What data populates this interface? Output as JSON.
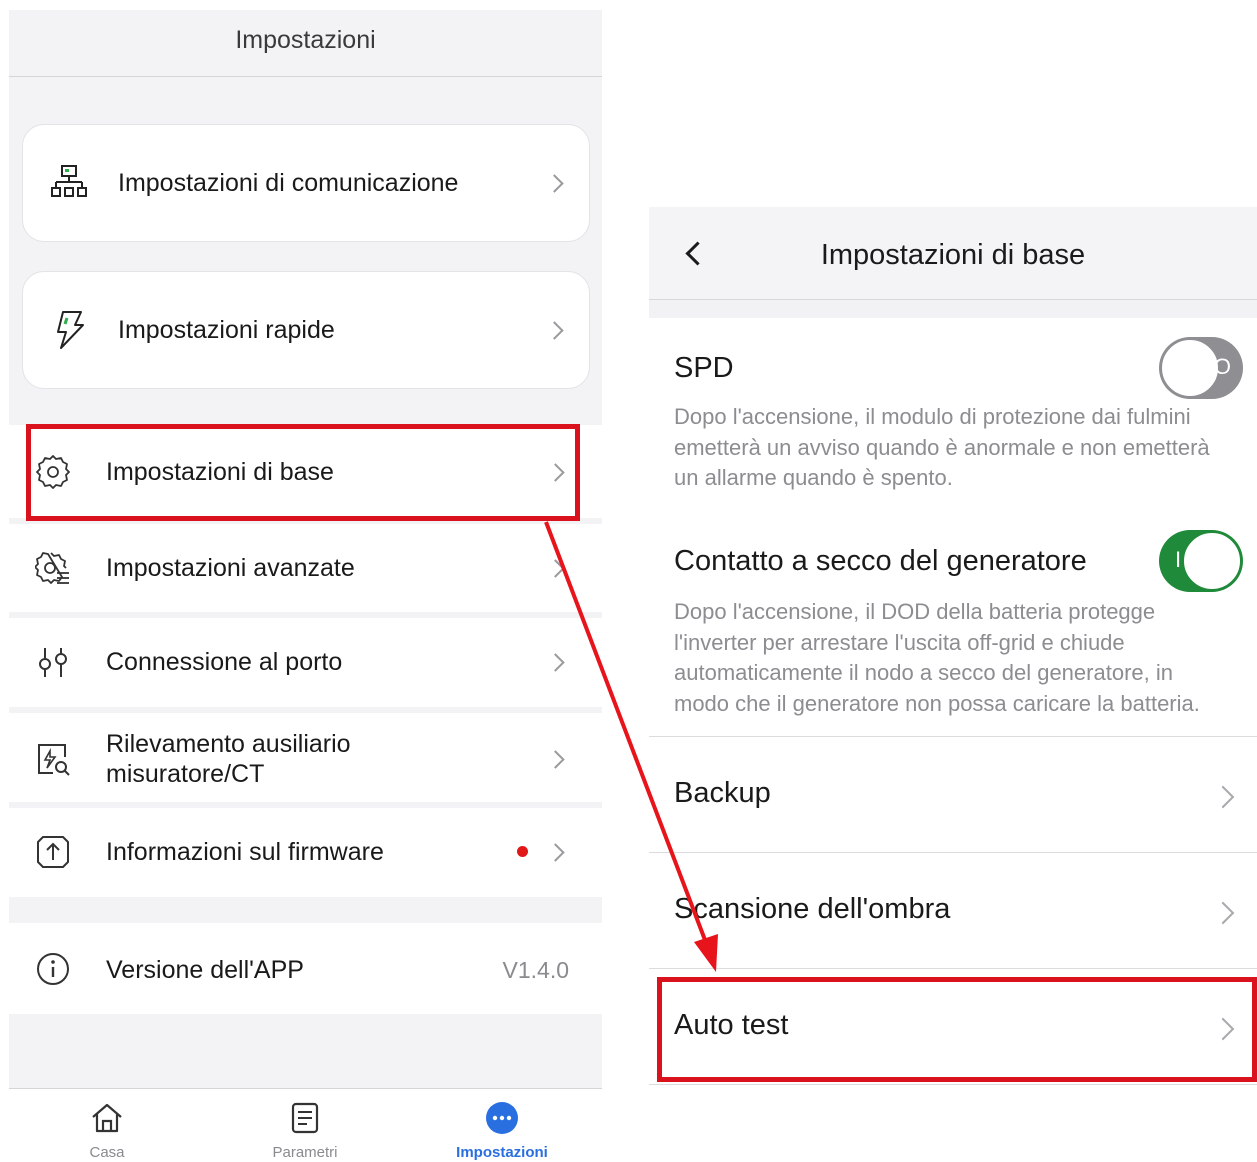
{
  "left_screen": {
    "title": "Impostazioni",
    "cards": [
      {
        "label": "Impostazioni di comunicazione",
        "icon": "network-icon"
      },
      {
        "label": "Impostazioni rapide",
        "icon": "lightning-icon"
      }
    ],
    "rows": [
      {
        "label": "Impostazioni di base",
        "icon": "gear-icon"
      },
      {
        "label": "Impostazioni avanzate",
        "icon": "advanced-gear-icon"
      },
      {
        "label": "Connessione al porto",
        "icon": "port-icon"
      },
      {
        "label_line1": "Rilevamento ausiliario",
        "label_line2": "misuratore/CT",
        "icon": "meter-search-icon"
      },
      {
        "label": "Informazioni sul firmware",
        "icon": "firmware-upload-icon"
      }
    ],
    "app_version": {
      "label": "Versione dell'APP",
      "value": "V1.4.0",
      "icon": "info-icon"
    },
    "tabs": [
      {
        "label": "Casa",
        "icon": "home-icon"
      },
      {
        "label": "Parametri",
        "icon": "document-icon"
      },
      {
        "label": "Impostazioni",
        "icon": "more-icon",
        "active": true
      }
    ]
  },
  "right_screen": {
    "title": "Impostazioni di base",
    "spd": {
      "title": "SPD",
      "description": "Dopo l'accensione, il modulo di protezione dai fulmini emetterà un avviso quando è anormale e non emetterà un allarme quando è spento.",
      "toggle_state": "off",
      "toggle_symbol": "O"
    },
    "generator": {
      "title": "Contatto a secco del generatore",
      "description": "Dopo l'accensione, il DOD della batteria protegge l'inverter per arrestare l'uscita off-grid e chiude automaticamente il nodo a secco del generatore, in modo che il generatore non possa caricare la batteria.",
      "toggle_state": "on",
      "toggle_symbol": "I"
    },
    "rows": [
      {
        "label": "Backup"
      },
      {
        "label": "Scansione dell'ombra"
      },
      {
        "label": "Auto test"
      }
    ]
  },
  "colors": {
    "highlight": "#d9121e",
    "toggle_on": "#1f8a3a",
    "toggle_off": "#8e8e93",
    "active_tab": "#2a6fe0",
    "notification_dot": "#e01818"
  }
}
